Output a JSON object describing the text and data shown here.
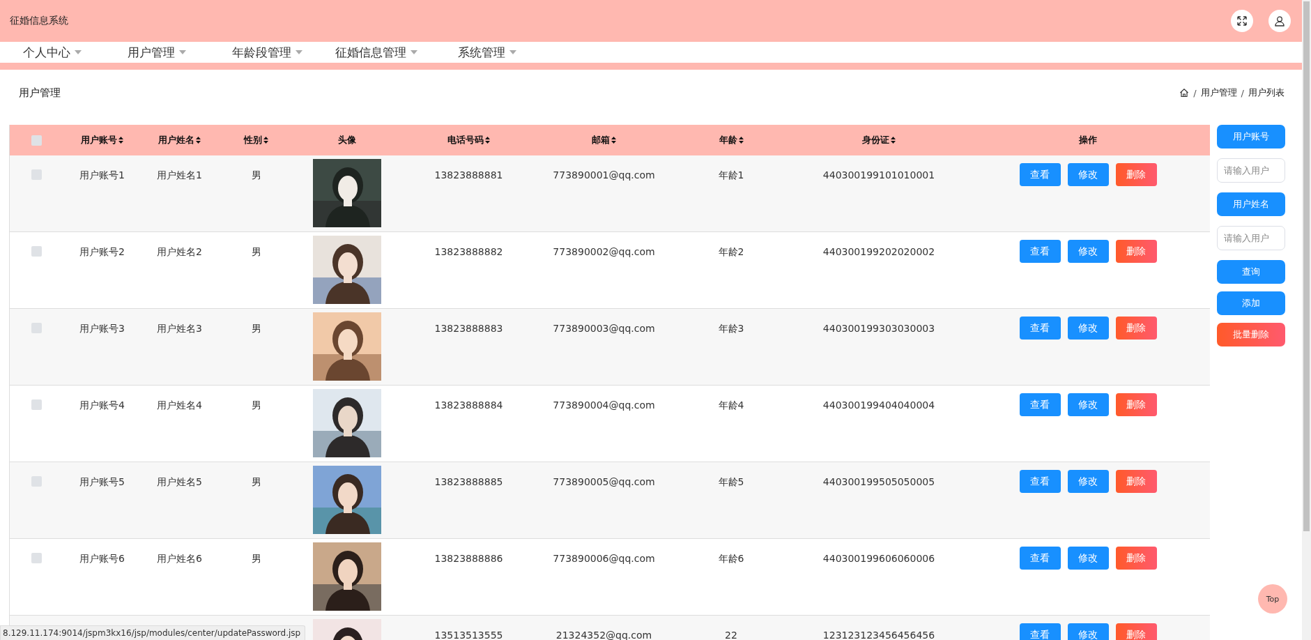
{
  "header": {
    "title": "征婚信息系统"
  },
  "nav": [
    {
      "label": "个人中心"
    },
    {
      "label": "用户管理"
    },
    {
      "label": "年龄段管理"
    },
    {
      "label": "征婚信息管理"
    },
    {
      "label": "系统管理"
    }
  ],
  "page_title": "用户管理",
  "breadcrumb": [
    {
      "separator": "/",
      "label": "用户管理"
    },
    {
      "separator": "/",
      "label": "用户列表"
    }
  ],
  "table": {
    "select_all": {
      "checked": false
    },
    "columns": [
      {
        "label": "用户账号",
        "sortable": true
      },
      {
        "label": "用户姓名",
        "sortable": true
      },
      {
        "label": "性别",
        "sortable": true
      },
      {
        "label": "头像",
        "sortable": false
      },
      {
        "label": "电话号码",
        "sortable": true
      },
      {
        "label": "邮箱",
        "sortable": true
      },
      {
        "label": "年龄",
        "sortable": true
      },
      {
        "label": "身份证",
        "sortable": true
      },
      {
        "label": "操作",
        "sortable": false
      }
    ],
    "rows": [
      {
        "checked": false,
        "account": "用户账号1",
        "name": "用户姓名1",
        "gender": "男",
        "phone": "13823888881",
        "email": "773890001@qq.com",
        "age": "年龄1",
        "id_card": "440300199101010001",
        "actions": [
          {
            "label": "查看",
            "kind": "primary"
          },
          {
            "label": "修改",
            "kind": "primary"
          },
          {
            "label": "删除",
            "kind": "danger"
          }
        ]
      },
      {
        "checked": false,
        "account": "用户账号2",
        "name": "用户姓名2",
        "gender": "男",
        "phone": "13823888882",
        "email": "773890002@qq.com",
        "age": "年龄2",
        "id_card": "440300199202020002",
        "actions": [
          {
            "label": "查看",
            "kind": "primary"
          },
          {
            "label": "修改",
            "kind": "primary"
          },
          {
            "label": "删除",
            "kind": "danger"
          }
        ]
      },
      {
        "checked": false,
        "account": "用户账号3",
        "name": "用户姓名3",
        "gender": "男",
        "phone": "13823888883",
        "email": "773890003@qq.com",
        "age": "年龄3",
        "id_card": "440300199303030003",
        "actions": [
          {
            "label": "查看",
            "kind": "primary"
          },
          {
            "label": "修改",
            "kind": "primary"
          },
          {
            "label": "删除",
            "kind": "danger"
          }
        ]
      },
      {
        "checked": false,
        "account": "用户账号4",
        "name": "用户姓名4",
        "gender": "男",
        "phone": "13823888884",
        "email": "773890004@qq.com",
        "age": "年龄4",
        "id_card": "440300199404040004",
        "actions": [
          {
            "label": "查看",
            "kind": "primary"
          },
          {
            "label": "修改",
            "kind": "primary"
          },
          {
            "label": "删除",
            "kind": "danger"
          }
        ]
      },
      {
        "checked": false,
        "account": "用户账号5",
        "name": "用户姓名5",
        "gender": "男",
        "phone": "13823888885",
        "email": "773890005@qq.com",
        "age": "年龄5",
        "id_card": "440300199505050005",
        "actions": [
          {
            "label": "查看",
            "kind": "primary"
          },
          {
            "label": "修改",
            "kind": "primary"
          },
          {
            "label": "删除",
            "kind": "danger"
          }
        ]
      },
      {
        "checked": false,
        "account": "用户账号6",
        "name": "用户姓名6",
        "gender": "男",
        "phone": "13823888886",
        "email": "773890006@qq.com",
        "age": "年龄6",
        "id_card": "440300199606060006",
        "actions": [
          {
            "label": "查看",
            "kind": "primary"
          },
          {
            "label": "修改",
            "kind": "primary"
          },
          {
            "label": "删除",
            "kind": "danger"
          }
        ]
      },
      {
        "phone": "13513513555",
        "email": "21324352@qq.com",
        "age": "22",
        "id_card": "123123123456456456",
        "actions": [
          {
            "label": "查看",
            "kind": "primary"
          },
          {
            "label": "修改",
            "kind": "primary"
          },
          {
            "label": "删除",
            "kind": "danger"
          }
        ]
      }
    ]
  },
  "search_panel": [
    {
      "kind": "label",
      "text": "用户账号"
    },
    {
      "kind": "input",
      "placeholder": "请输入用户"
    },
    {
      "kind": "label",
      "text": "用户姓名"
    },
    {
      "kind": "input",
      "placeholder": "请输入用户"
    },
    {
      "kind": "button",
      "text": "查询"
    },
    {
      "kind": "button",
      "text": "添加"
    },
    {
      "kind": "danger",
      "text": "批量删除"
    }
  ],
  "status_url": "8.129.11.174:9014/jspm3kx16/jsp/modules/center/updatePassword.jsp",
  "back_to_top": "Top"
}
